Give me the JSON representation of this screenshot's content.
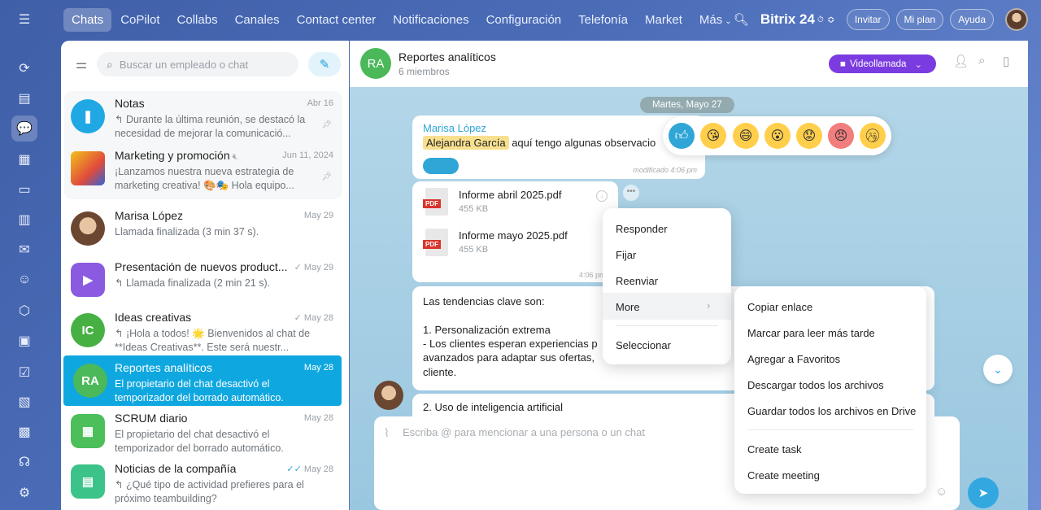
{
  "topnav": {
    "items": [
      "Chats",
      "CoPilot",
      "Collabs",
      "Canales",
      "Contact center",
      "Notificaciones",
      "Configuración",
      "Telefonía",
      "Market",
      "Más"
    ],
    "brand": "Bitrix 24",
    "buttons": [
      "Invitar",
      "Mi plan",
      "Ayuda"
    ]
  },
  "sidebar": {
    "search_placeholder": "Buscar un empleado o chat",
    "chats": [
      {
        "name": "Notas",
        "date": "Abr 16",
        "msg": "↰ Durante la última reunión, se destacó la necesidad de mejorar la comunicació...",
        "avatar_color": "#1fa8e4",
        "initials": "",
        "pinned": true
      },
      {
        "name": "Marketing y promoción",
        "date": "Jun 11, 2024",
        "msg": "¡Lanzamos nuestra nueva estrategia de marketing creativa! 🎨🎭 Hola equipo...",
        "avatar_color": "#e14b3b",
        "initials": "",
        "pinned": true
      },
      {
        "name": "Marisa López",
        "date": "May 29",
        "msg": "Llamada finalizada (3 min 37 s).",
        "avatar_color": "#b27a55",
        "initials": "",
        "pinned": false
      },
      {
        "name": "Presentación de nuevos product...",
        "date": "May 29",
        "msg": "↰ Llamada finalizada (2 min 21 s).",
        "avatar_color": "#8a5be0",
        "initials": "",
        "pinned": false
      },
      {
        "name": "Ideas creativas",
        "date": "May 28",
        "msg": "↰ ¡Hola a todos! 🌟 Bienvenidos al chat de **Ideas Creativas**. Este será nuestr...",
        "avatar_color": "#47b043",
        "initials": "IC",
        "pinned": false
      },
      {
        "name": "Reportes analíticos",
        "date": "May 28",
        "msg": "El propietario del chat desactivó el temporizador del borrado automático.",
        "avatar_color": "#4bb85a",
        "initials": "RA",
        "pinned": false
      },
      {
        "name": "SCRUM diario",
        "date": "May 28",
        "msg": "El propietario del chat desactivó el temporizador del borrado automático.",
        "avatar_color": "#4cbf5a",
        "initials": "",
        "pinned": false
      },
      {
        "name": "Noticias de la compañía",
        "date": "May 28",
        "msg": "↰ ¿Qué tipo de actividad prefieres para el próximo teambuilding?",
        "avatar_color": "#3cc38a",
        "initials": "",
        "pinned": false
      }
    ]
  },
  "chat": {
    "initials": "RA",
    "title": "Reportes analíticos",
    "subtitle": "6 miembros",
    "video_label": "Videollamada",
    "date_separator": "Martes, Mayo 27",
    "msg1": {
      "author": "Marisa López",
      "mention": "Alejandra García",
      "text": "aquí tengo algunas observacio",
      "status": "modificado",
      "time": "4:06 pm"
    },
    "files": [
      {
        "name": "Informe abril 2025.pdf",
        "size": "455 KB"
      },
      {
        "name": "Informe mayo 2025.pdf",
        "size": "455 KB"
      }
    ],
    "files_time": "4:06 pm",
    "file_ext": "PDF",
    "msg3": {
      "line1": "Las tendencias clave son:",
      "line2": "1. Personalización extrema",
      "line3": "- Los clientes esperan experiencias p",
      "line4": "avanzados para adaptar sus ofertas,",
      "line5": "cliente.",
      "line6": "2. Uso de inteligencia artificial"
    },
    "composer_placeholder": "Escriba @ para mencionar a una persona o un chat"
  },
  "context_menu": {
    "items": [
      "Responder",
      "Fijar",
      "Reenviar",
      "More",
      "Seleccionar"
    ]
  },
  "submenu": {
    "items": [
      "Copiar enlace",
      "Marcar para leer más tarde",
      "Agregar a Favoritos",
      "Descargar todos los archivos",
      "Guardar todos los archivos en Drive",
      "Create task",
      "Create meeting"
    ]
  },
  "colors": {
    "accent": "#0fa7e0",
    "video": "#7a3ce0",
    "mention": "#f8e08e"
  }
}
